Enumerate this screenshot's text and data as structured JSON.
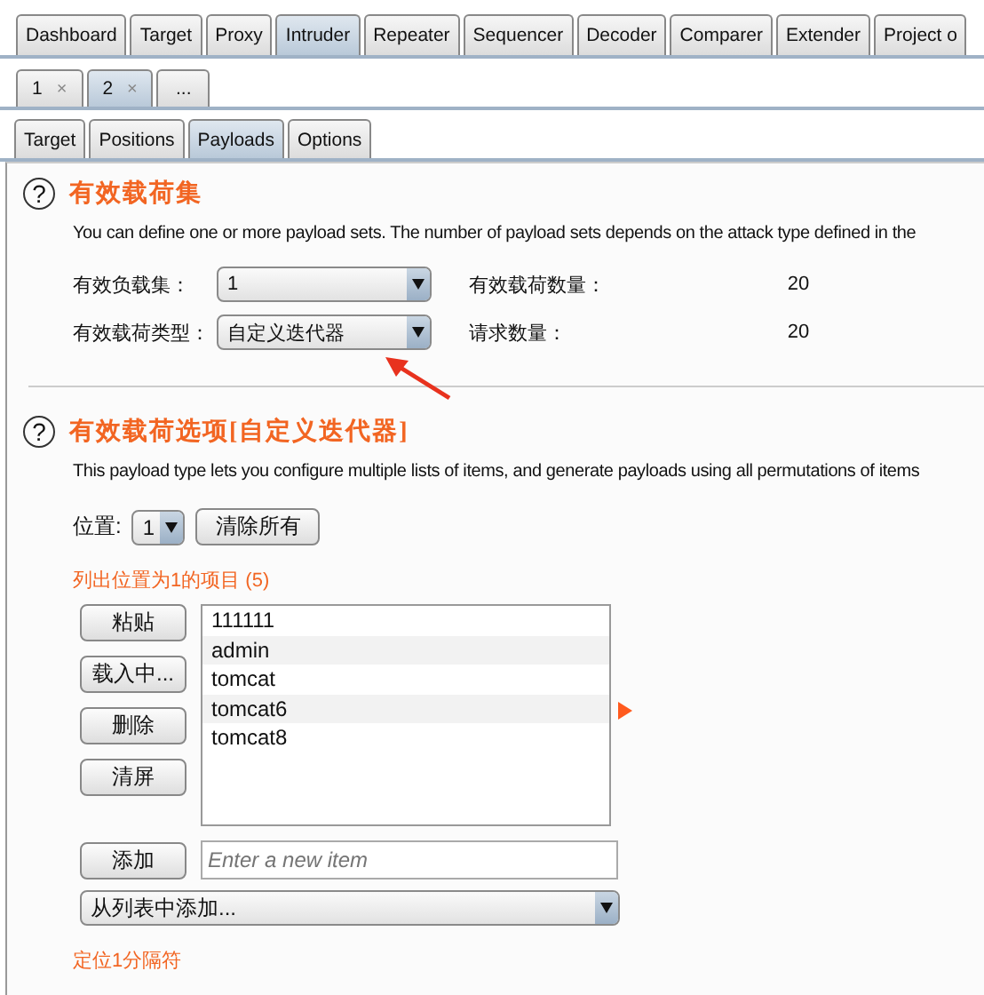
{
  "main_tabs": [
    {
      "label": "Dashboard",
      "selected": false
    },
    {
      "label": "Target",
      "selected": false
    },
    {
      "label": "Proxy",
      "selected": false
    },
    {
      "label": "Intruder",
      "selected": true
    },
    {
      "label": "Repeater",
      "selected": false
    },
    {
      "label": "Sequencer",
      "selected": false
    },
    {
      "label": "Decoder",
      "selected": false
    },
    {
      "label": "Comparer",
      "selected": false
    },
    {
      "label": "Extender",
      "selected": false
    },
    {
      "label": "Project o",
      "selected": false
    }
  ],
  "request_tabs": [
    {
      "label": "1",
      "close": "×",
      "selected": false
    },
    {
      "label": "2",
      "close": "×",
      "selected": true
    },
    {
      "label": "...",
      "selected": false
    }
  ],
  "sub_tabs": [
    {
      "label": "Target",
      "selected": false
    },
    {
      "label": "Positions",
      "selected": false
    },
    {
      "label": "Payloads",
      "selected": true
    },
    {
      "label": "Options",
      "selected": false
    }
  ],
  "help_glyph": "?",
  "payload_sets": {
    "title": "有效载荷集",
    "description": "You can define one or more payload sets. The number of payload sets depends on the attack type defined in the",
    "rows": [
      {
        "label": "有效负载集：",
        "value": "1",
        "stat_label": "有效载荷数量：",
        "stat_value": "20"
      },
      {
        "label": "有效载荷类型：",
        "value": "自定义迭代器",
        "stat_label": "请求数量：",
        "stat_value": "20"
      }
    ]
  },
  "payload_options": {
    "title": "有效载荷选项[自定义迭代器]",
    "description": "This payload type lets you configure multiple lists of items, and generate payloads using all permutations of items",
    "position_label": "位置:",
    "position_value": "1",
    "clear_all_button": "清除所有",
    "list_label": "列出位置为1的项目 (5)",
    "buttons": [
      "粘贴",
      "载入中...",
      "删除",
      "清屏"
    ],
    "items": [
      "111111",
      "admin",
      "tomcat",
      "tomcat6",
      "tomcat8"
    ],
    "add_button": "添加",
    "new_item_placeholder": "Enter a new item",
    "add_from_list": "从列表中添加...",
    "delimiter_label": "定位1分隔符"
  }
}
